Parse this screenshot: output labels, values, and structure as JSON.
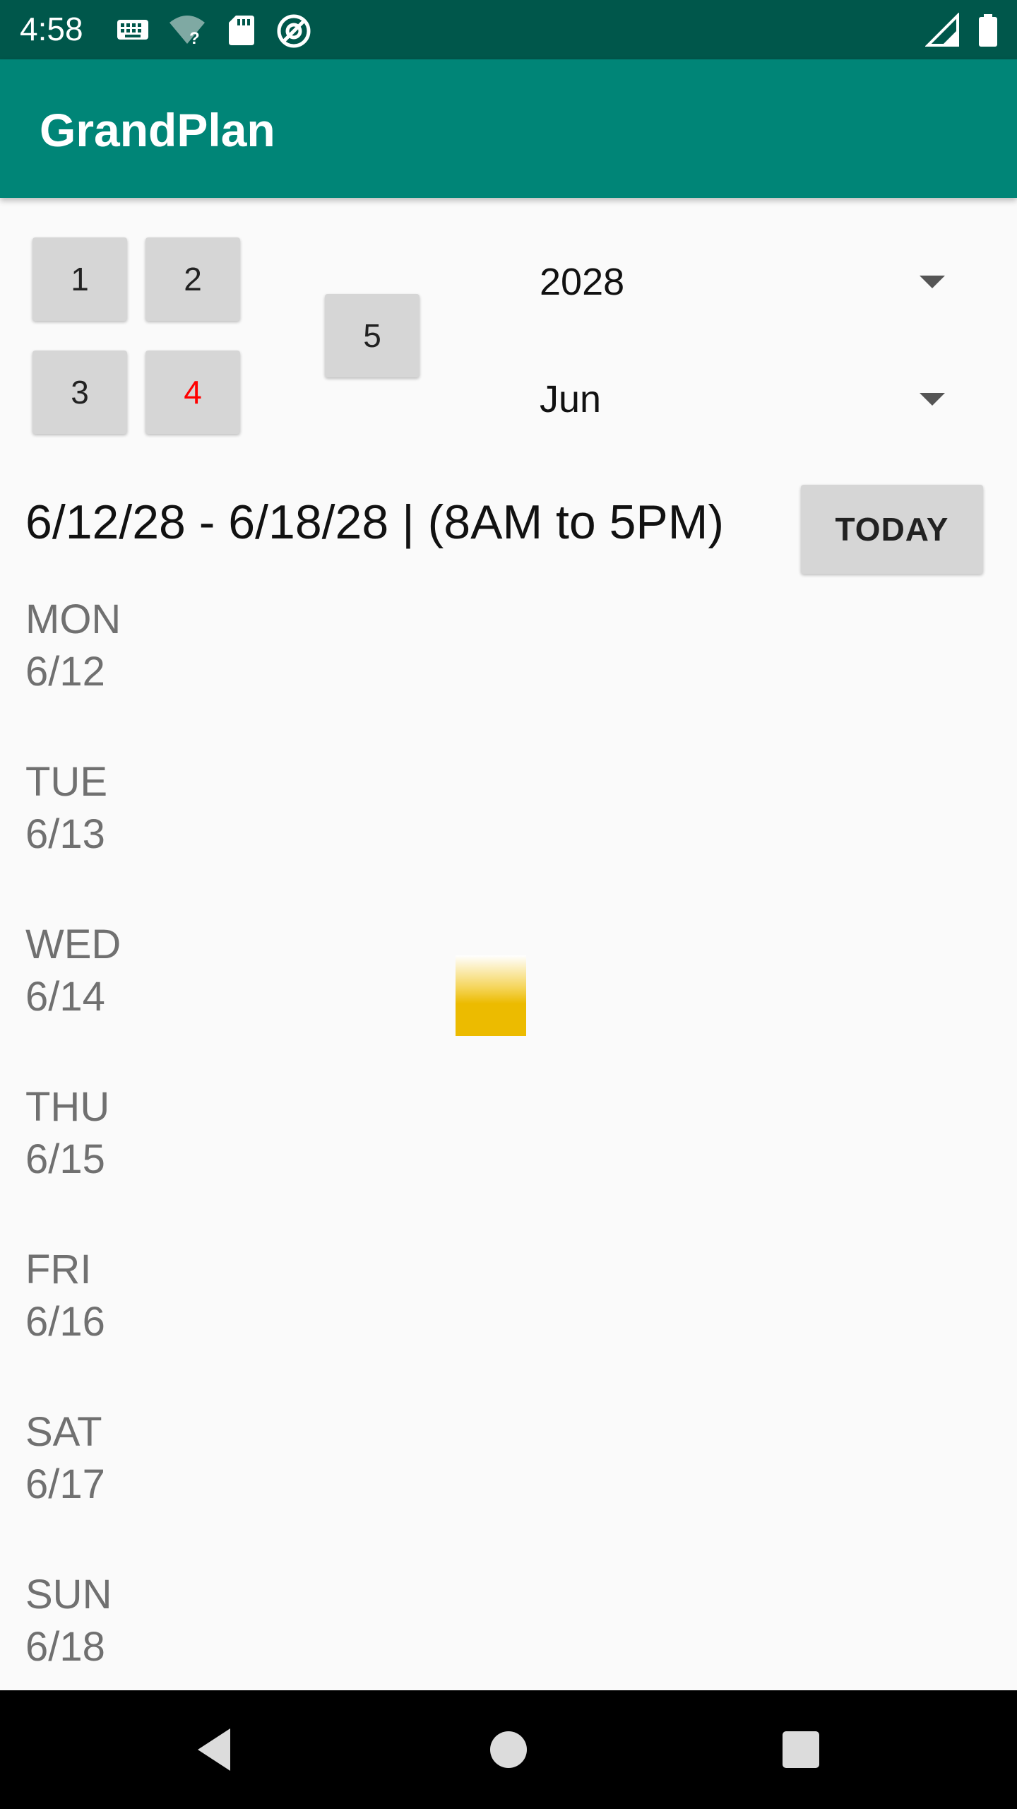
{
  "status_bar": {
    "time": "4:58",
    "icons": [
      "keyboard-icon",
      "wifi-unknown-icon",
      "sd-card-icon",
      "do-not-disturb-icon",
      "signal-icon",
      "battery-icon"
    ]
  },
  "app_bar": {
    "title": "GrandPlan"
  },
  "view_buttons": [
    "1",
    "2",
    "3",
    "4",
    "5"
  ],
  "active_color": "#ff0000",
  "year_spinner": {
    "value": "2028"
  },
  "month_spinner": {
    "value": "Jun"
  },
  "range": {
    "text": "6/12/28 - 6/18/28 | (8AM to 5PM)"
  },
  "today_button": {
    "label": "TODAY"
  },
  "days": [
    {
      "name": "MON",
      "date": "6/12"
    },
    {
      "name": "TUE",
      "date": "6/13"
    },
    {
      "name": "WED",
      "date": "6/14"
    },
    {
      "name": "THU",
      "date": "6/15"
    },
    {
      "name": "FRI",
      "date": "6/16"
    },
    {
      "name": "SAT",
      "date": "6/17"
    },
    {
      "name": "SUN",
      "date": "6/18"
    }
  ],
  "event_color": "#ecbb00",
  "nav_bar": {
    "icons": [
      "back-icon",
      "home-icon",
      "recents-icon"
    ]
  }
}
